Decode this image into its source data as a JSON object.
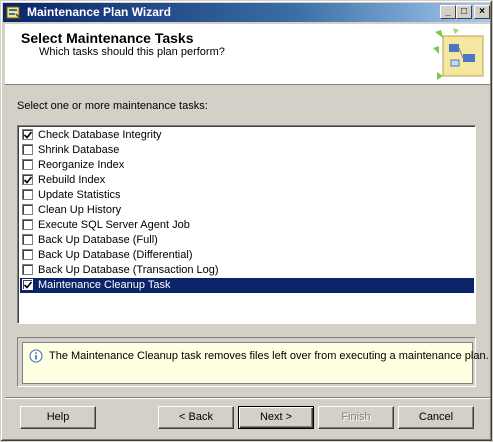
{
  "window": {
    "title": "Maintenance Plan Wizard",
    "buttons": {
      "minimize": "_",
      "maximize": "□",
      "close": "×"
    }
  },
  "header": {
    "title": "Select Maintenance Tasks",
    "subtitle": "Which tasks should this plan perform?"
  },
  "prompt": "Select one or more maintenance tasks:",
  "tasks": [
    {
      "label": "Check Database Integrity",
      "checked": true
    },
    {
      "label": "Shrink Database",
      "checked": false
    },
    {
      "label": "Reorganize Index",
      "checked": false
    },
    {
      "label": "Rebuild Index",
      "checked": true
    },
    {
      "label": "Update Statistics",
      "checked": false
    },
    {
      "label": "Clean Up History",
      "checked": false
    },
    {
      "label": "Execute SQL Server Agent Job",
      "checked": false
    },
    {
      "label": "Back Up Database (Full)",
      "checked": false
    },
    {
      "label": "Back Up Database (Differential)",
      "checked": false
    },
    {
      "label": "Back Up Database (Transaction Log)",
      "checked": false
    },
    {
      "label": "Maintenance Cleanup Task",
      "checked": true,
      "selected": true
    }
  ],
  "info": {
    "text": "The Maintenance Cleanup task removes files left over from executing a maintenance plan."
  },
  "footer": {
    "help": "Help",
    "back": "< Back",
    "next": "Next >",
    "finish": "Finish",
    "cancel": "Cancel"
  },
  "colors": {
    "selection": "#0a246a",
    "info_background": "#ffffe1",
    "dialog_background": "#d4d0c8"
  }
}
